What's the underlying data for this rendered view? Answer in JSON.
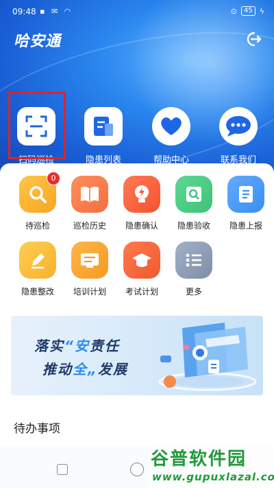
{
  "status_bar": {
    "time": "09:48",
    "battery": "45"
  },
  "app": {
    "title": "哈安通"
  },
  "quick_actions": [
    {
      "label": "扫码巡检",
      "icon": "scan-icon"
    },
    {
      "label": "隐患列表",
      "icon": "document-list-icon"
    },
    {
      "label": "帮助中心",
      "icon": "heart-icon"
    },
    {
      "label": "联系我们",
      "icon": "chat-bubble-icon"
    }
  ],
  "grid": [
    {
      "label": "待巡检",
      "icon": "magnifier-icon",
      "color": "#f6a623",
      "badge": "0"
    },
    {
      "label": "巡检历史",
      "icon": "book-icon",
      "color": "#f2703e"
    },
    {
      "label": "隐患确认",
      "icon": "lightning-bulb-icon",
      "color": "#f4522f"
    },
    {
      "label": "隐患验收",
      "icon": "search-document-icon",
      "color": "#3ec27a"
    },
    {
      "label": "隐患上报",
      "icon": "report-icon",
      "color": "#3a8ff2"
    },
    {
      "label": "隐患整改",
      "icon": "pencil-icon",
      "color": "#f7b22c"
    },
    {
      "label": "培训计划",
      "icon": "training-icon",
      "color": "#f59a23"
    },
    {
      "label": "考试计划",
      "icon": "graduation-cap-icon",
      "color": "#ef5a2e"
    },
    {
      "label": "更多",
      "icon": "list-icon",
      "color": "#7f8ea8"
    }
  ],
  "banner": {
    "line1_a": "落实",
    "line1_hl": "“安",
    "line1_b": "责任",
    "line2_a": "推动",
    "line2_hl": "全„",
    "line2_b": "发展"
  },
  "todo": {
    "title": "待办事项"
  },
  "watermark": {
    "top": "谷普软件园",
    "bottom": "www.gupuxlazal.com"
  }
}
